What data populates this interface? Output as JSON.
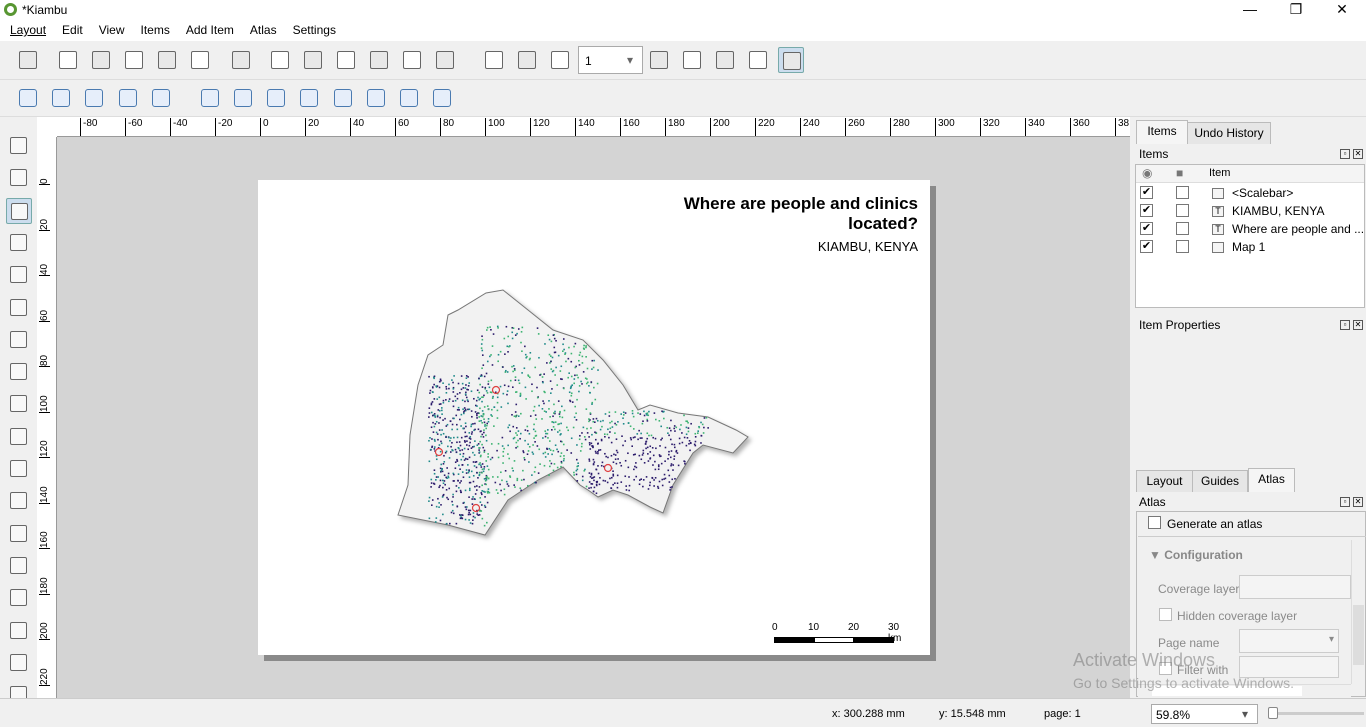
{
  "window": {
    "title": "*Kiambu",
    "minimize": "—",
    "maximize": "❐",
    "close": "✕"
  },
  "menu": [
    "Layout",
    "Edit",
    "View",
    "Items",
    "Add Item",
    "Atlas",
    "Settings"
  ],
  "toolbar1": {
    "icons": [
      "save-icon",
      "new-layout-icon",
      "duplicate-layout-icon",
      "layout-manager-icon",
      "open-template-icon",
      "save-template-icon",
      "page-setup-icon",
      "print-icon",
      "export-image-icon",
      "export-svg-icon",
      "export-pdf-icon",
      "undo-icon",
      "redo-icon",
      "atlas-preview-icon",
      "first-feature-icon",
      "prev-feature-icon",
      "next-feature-icon",
      "last-feature-icon",
      "atlas-print-icon",
      "atlas-export-icon",
      "atlas-settings-icon"
    ],
    "atlas_page": "1"
  },
  "toolbar2": {
    "icons": [
      "zoom-in-icon",
      "zoom-out-icon",
      "zoom-actual-icon",
      "zoom-full-icon",
      "refresh-icon",
      "lock-items-icon",
      "unlock-items-icon",
      "group-icon",
      "ungroup-icon",
      "raise-icon",
      "align-left-icon",
      "distribute-icon",
      "resize-icon"
    ]
  },
  "left_tools": [
    "pan-icon",
    "zoom-tool-icon",
    "select-move-icon",
    "move-content-icon",
    "edit-nodes-icon",
    "add-map-icon",
    "add-3d-map-icon",
    "add-picture-icon",
    "add-label-icon",
    "add-legend-icon",
    "add-scalebar-icon",
    "add-north-arrow-icon",
    "add-shape-icon",
    "add-arrow-icon",
    "add-node-item-icon",
    "add-html-icon",
    "add-attribute-table-icon",
    "more-tools-icon"
  ],
  "rulers": {
    "h": [
      "-80",
      "-60",
      "-40",
      "-20",
      "0",
      "20",
      "40",
      "60",
      "80",
      "100",
      "120",
      "140",
      "160",
      "180",
      "200",
      "220",
      "240",
      "260",
      "280",
      "300",
      "320",
      "340",
      "360",
      "38"
    ],
    "v": [
      "0",
      "20",
      "40",
      "60",
      "80",
      "100",
      "120",
      "140",
      "160",
      "180",
      "200",
      "220"
    ]
  },
  "paper": {
    "title_line1": "Where are people and clinics",
    "title_line2": "located?",
    "subtitle": "KIAMBU, KENYA",
    "scalebar": {
      "labels": [
        "0",
        "10",
        "20",
        "30 km"
      ]
    }
  },
  "map_colors": {
    "people_dark": "#2b1b6b",
    "people_mid": "#1f8a8a",
    "people_green": "#3cb371",
    "clinic": "#e04040"
  },
  "panel": {
    "top_tabs": [
      "Items",
      "Undo History"
    ],
    "items_title": "Items",
    "items_header": "Item",
    "items": [
      {
        "label": "<Scalebar>",
        "visible": true,
        "locked": false
      },
      {
        "label": "KIAMBU, KENYA",
        "visible": true,
        "locked": false
      },
      {
        "label": "Where are people and ...",
        "visible": true,
        "locked": false
      },
      {
        "label": "Map 1",
        "visible": true,
        "locked": false
      }
    ],
    "item_properties": "Item Properties",
    "bottom_tabs": [
      "Layout",
      "Guides",
      "Atlas"
    ],
    "atlas_title": "Atlas",
    "generate_atlas": "Generate an atlas",
    "configuration": "Configuration",
    "coverage_layer": "Coverage layer",
    "hidden_coverage": "Hidden coverage layer",
    "page_name": "Page name",
    "filter_with": "Filter with"
  },
  "watermark": {
    "line1": "Activate Windows",
    "line2": "Go to Settings to activate Windows."
  },
  "status": {
    "x": "x: 300.288 mm",
    "y": "y: 15.548 mm",
    "page": "page: 1",
    "zoom": "59.8%"
  }
}
